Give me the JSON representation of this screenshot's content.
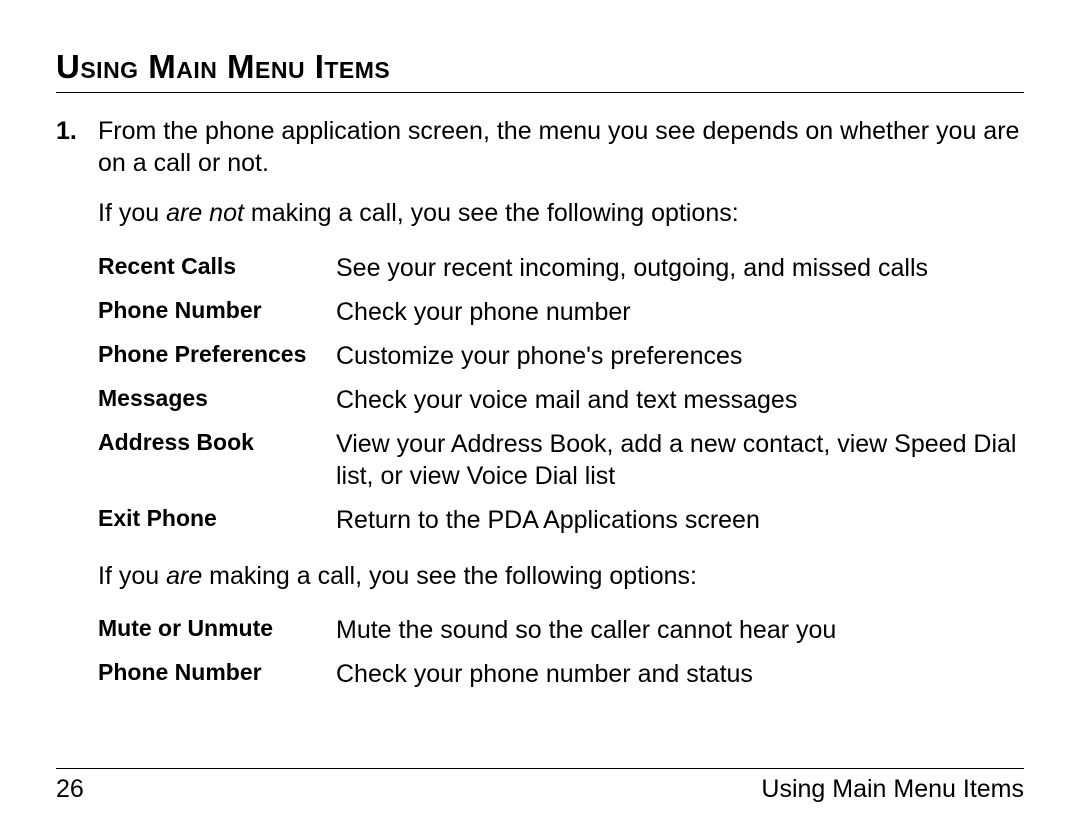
{
  "title": "Using Main Menu Items",
  "step_num": "1.",
  "step_text": "From the phone application screen, the menu you see depends on whether you are on a call or not.",
  "para_not_p1": "If you ",
  "para_not_em": "are not",
  "para_not_p2": " making a call, you see the following options:",
  "options_not": [
    {
      "label": "Recent Calls",
      "desc": "See your recent incoming, outgoing, and missed calls"
    },
    {
      "label": "Phone Number",
      "desc": "Check your phone number"
    },
    {
      "label": "Phone Preferences",
      "desc": "Customize your phone's preferences"
    },
    {
      "label": "Messages",
      "desc": "Check your voice mail and text messages"
    },
    {
      "label": "Address Book",
      "desc": "View your Address Book, add a new contact, view Speed Dial list, or view Voice Dial list"
    },
    {
      "label": "Exit Phone",
      "desc": "Return to the PDA Applications screen"
    }
  ],
  "para_are_p1": "If you ",
  "para_are_em": "are",
  "para_are_p2": " making a call, you see the following options:",
  "options_are": [
    {
      "label": "Mute or Unmute",
      "desc": "Mute the sound so the caller cannot hear you"
    },
    {
      "label": "Phone Number",
      "desc": "Check your phone number and status"
    }
  ],
  "footer_page": "26",
  "footer_text": "Using Main Menu Items"
}
